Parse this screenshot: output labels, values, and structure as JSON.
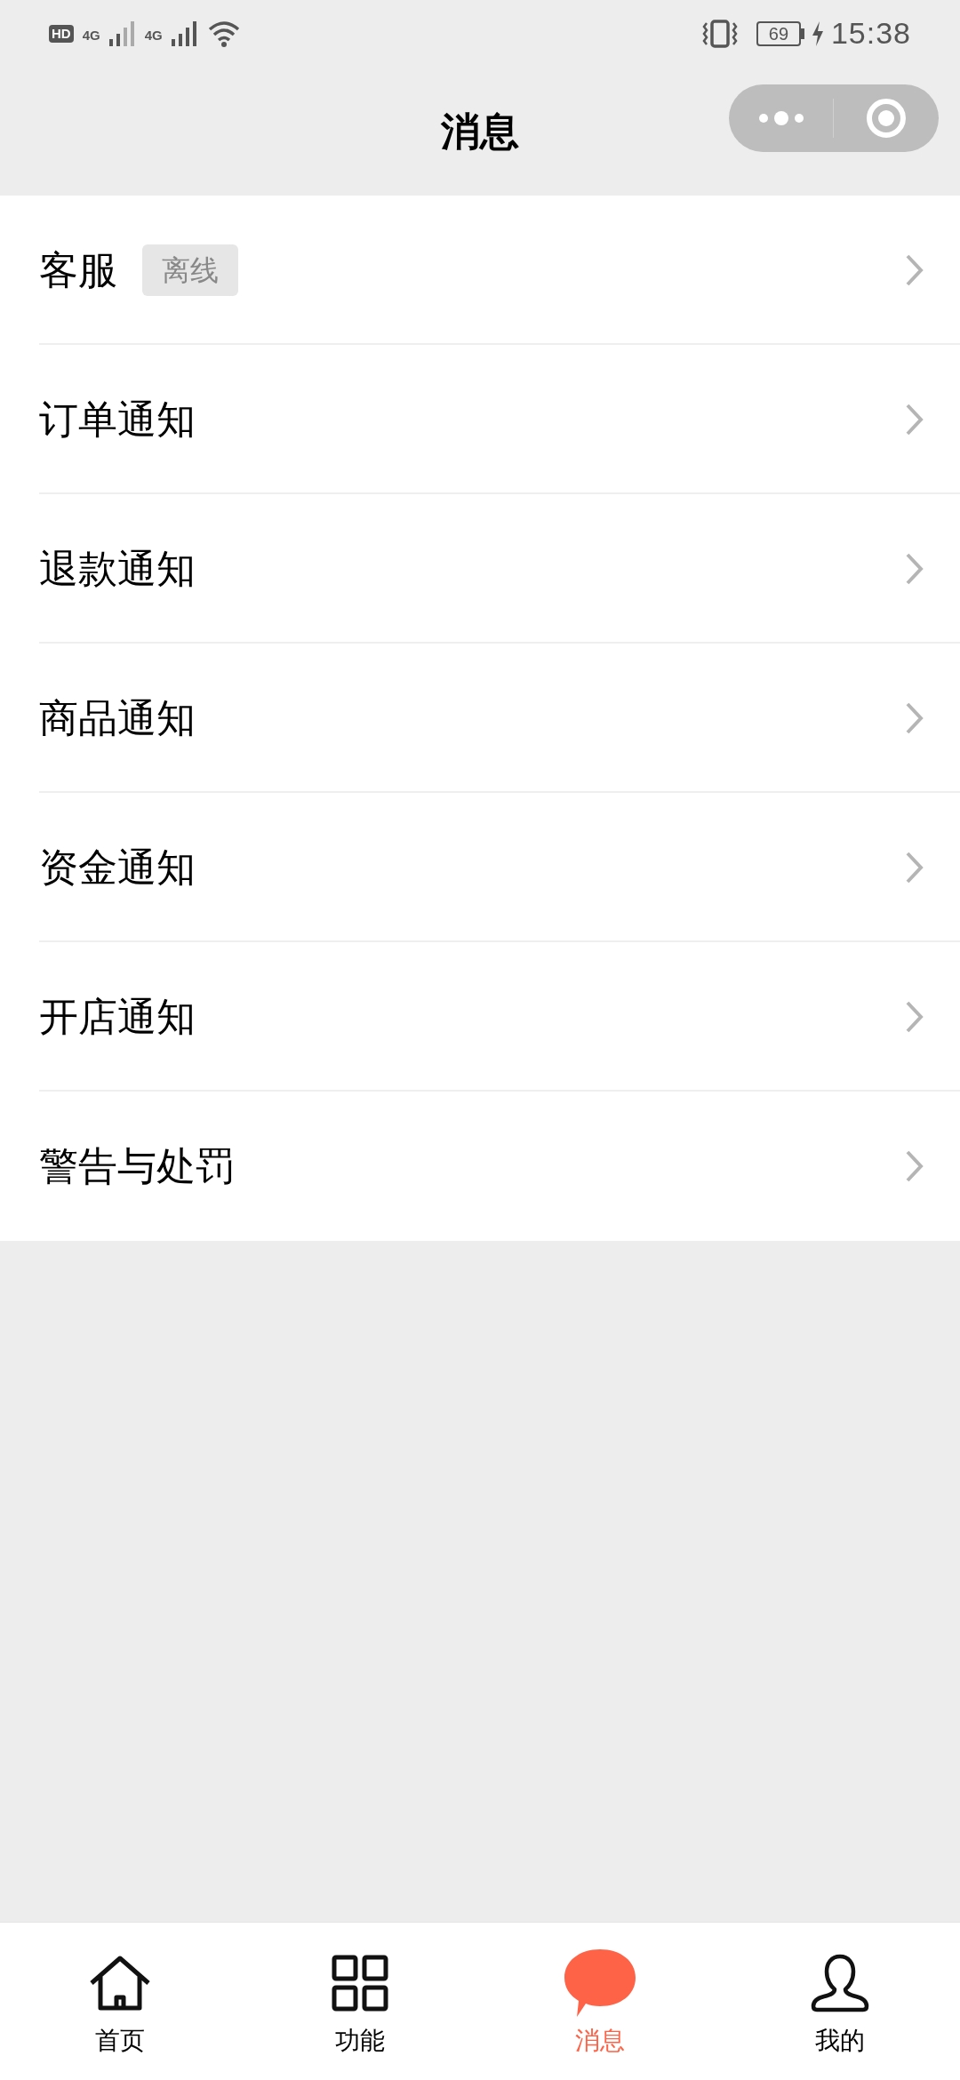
{
  "status_bar": {
    "hd": "HD",
    "network_1": "4G",
    "network_2": "4G",
    "battery": "69",
    "time": "15:38"
  },
  "header": {
    "title": "消息"
  },
  "items": [
    {
      "label": "客服",
      "badge": "离线"
    },
    {
      "label": "订单通知"
    },
    {
      "label": "退款通知"
    },
    {
      "label": "商品通知"
    },
    {
      "label": "资金通知"
    },
    {
      "label": "开店通知"
    },
    {
      "label": "警告与处罚"
    }
  ],
  "tab_bar": [
    {
      "kind": "home",
      "label": "首页",
      "selected": false
    },
    {
      "kind": "grid",
      "label": "功能",
      "selected": false
    },
    {
      "kind": "chat",
      "label": "消息",
      "selected": true
    },
    {
      "kind": "person",
      "label": "我的",
      "selected": false
    }
  ]
}
